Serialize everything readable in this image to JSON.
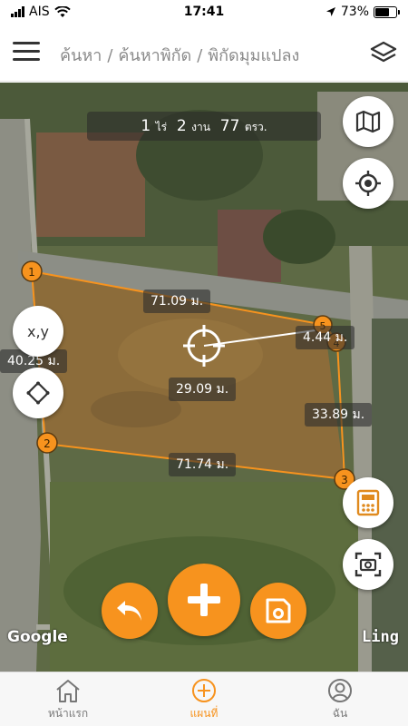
{
  "status_bar": {
    "carrier": "AIS",
    "time": "17:41",
    "battery_percent": "73%",
    "battery_level": 0.73,
    "icons": [
      "signal-bars-icon",
      "wifi-icon",
      "location-arrow-icon",
      "battery-icon"
    ]
  },
  "header": {
    "crumb_1": "ค้นหา",
    "separator": "/",
    "crumb_2": "ค้นหาพิกัด",
    "crumb_3": "พิกัดมุมแปลง",
    "menu_icon": "hamburger-icon",
    "layers_icon": "layers-icon"
  },
  "map": {
    "area": {
      "rai_value": "1",
      "rai_unit": "ไร่",
      "ngan_value": "2",
      "ngan_unit": "งาน",
      "wa_value": "77",
      "wa_unit": "ตรว."
    },
    "vertices": [
      "1",
      "2",
      "3",
      "4",
      "5"
    ],
    "edges": {
      "top": "71.09 ม.",
      "left": "40.25 ม.",
      "bottom": "71.74 ม.",
      "right": "33.89 ม.",
      "short": "4.44 ม.",
      "center_distance": "29.09 ม."
    },
    "xy_button": "x,y",
    "google_label": "Google",
    "imagery_label": "Ling",
    "accent_color": "#f7931e"
  },
  "right_buttons": [
    "map-icon",
    "crosshair-target-icon",
    "calculator-icon",
    "camera-scan-icon"
  ],
  "action_buttons": [
    "undo-icon",
    "add-plus-icon",
    "save-icon"
  ],
  "tabs": [
    {
      "label": "หน้าแรก",
      "icon": "home-icon",
      "active": false
    },
    {
      "label": "แผนที่",
      "icon": "add-circle-icon",
      "active": true
    },
    {
      "label": "ฉัน",
      "icon": "user-icon",
      "active": false
    }
  ]
}
